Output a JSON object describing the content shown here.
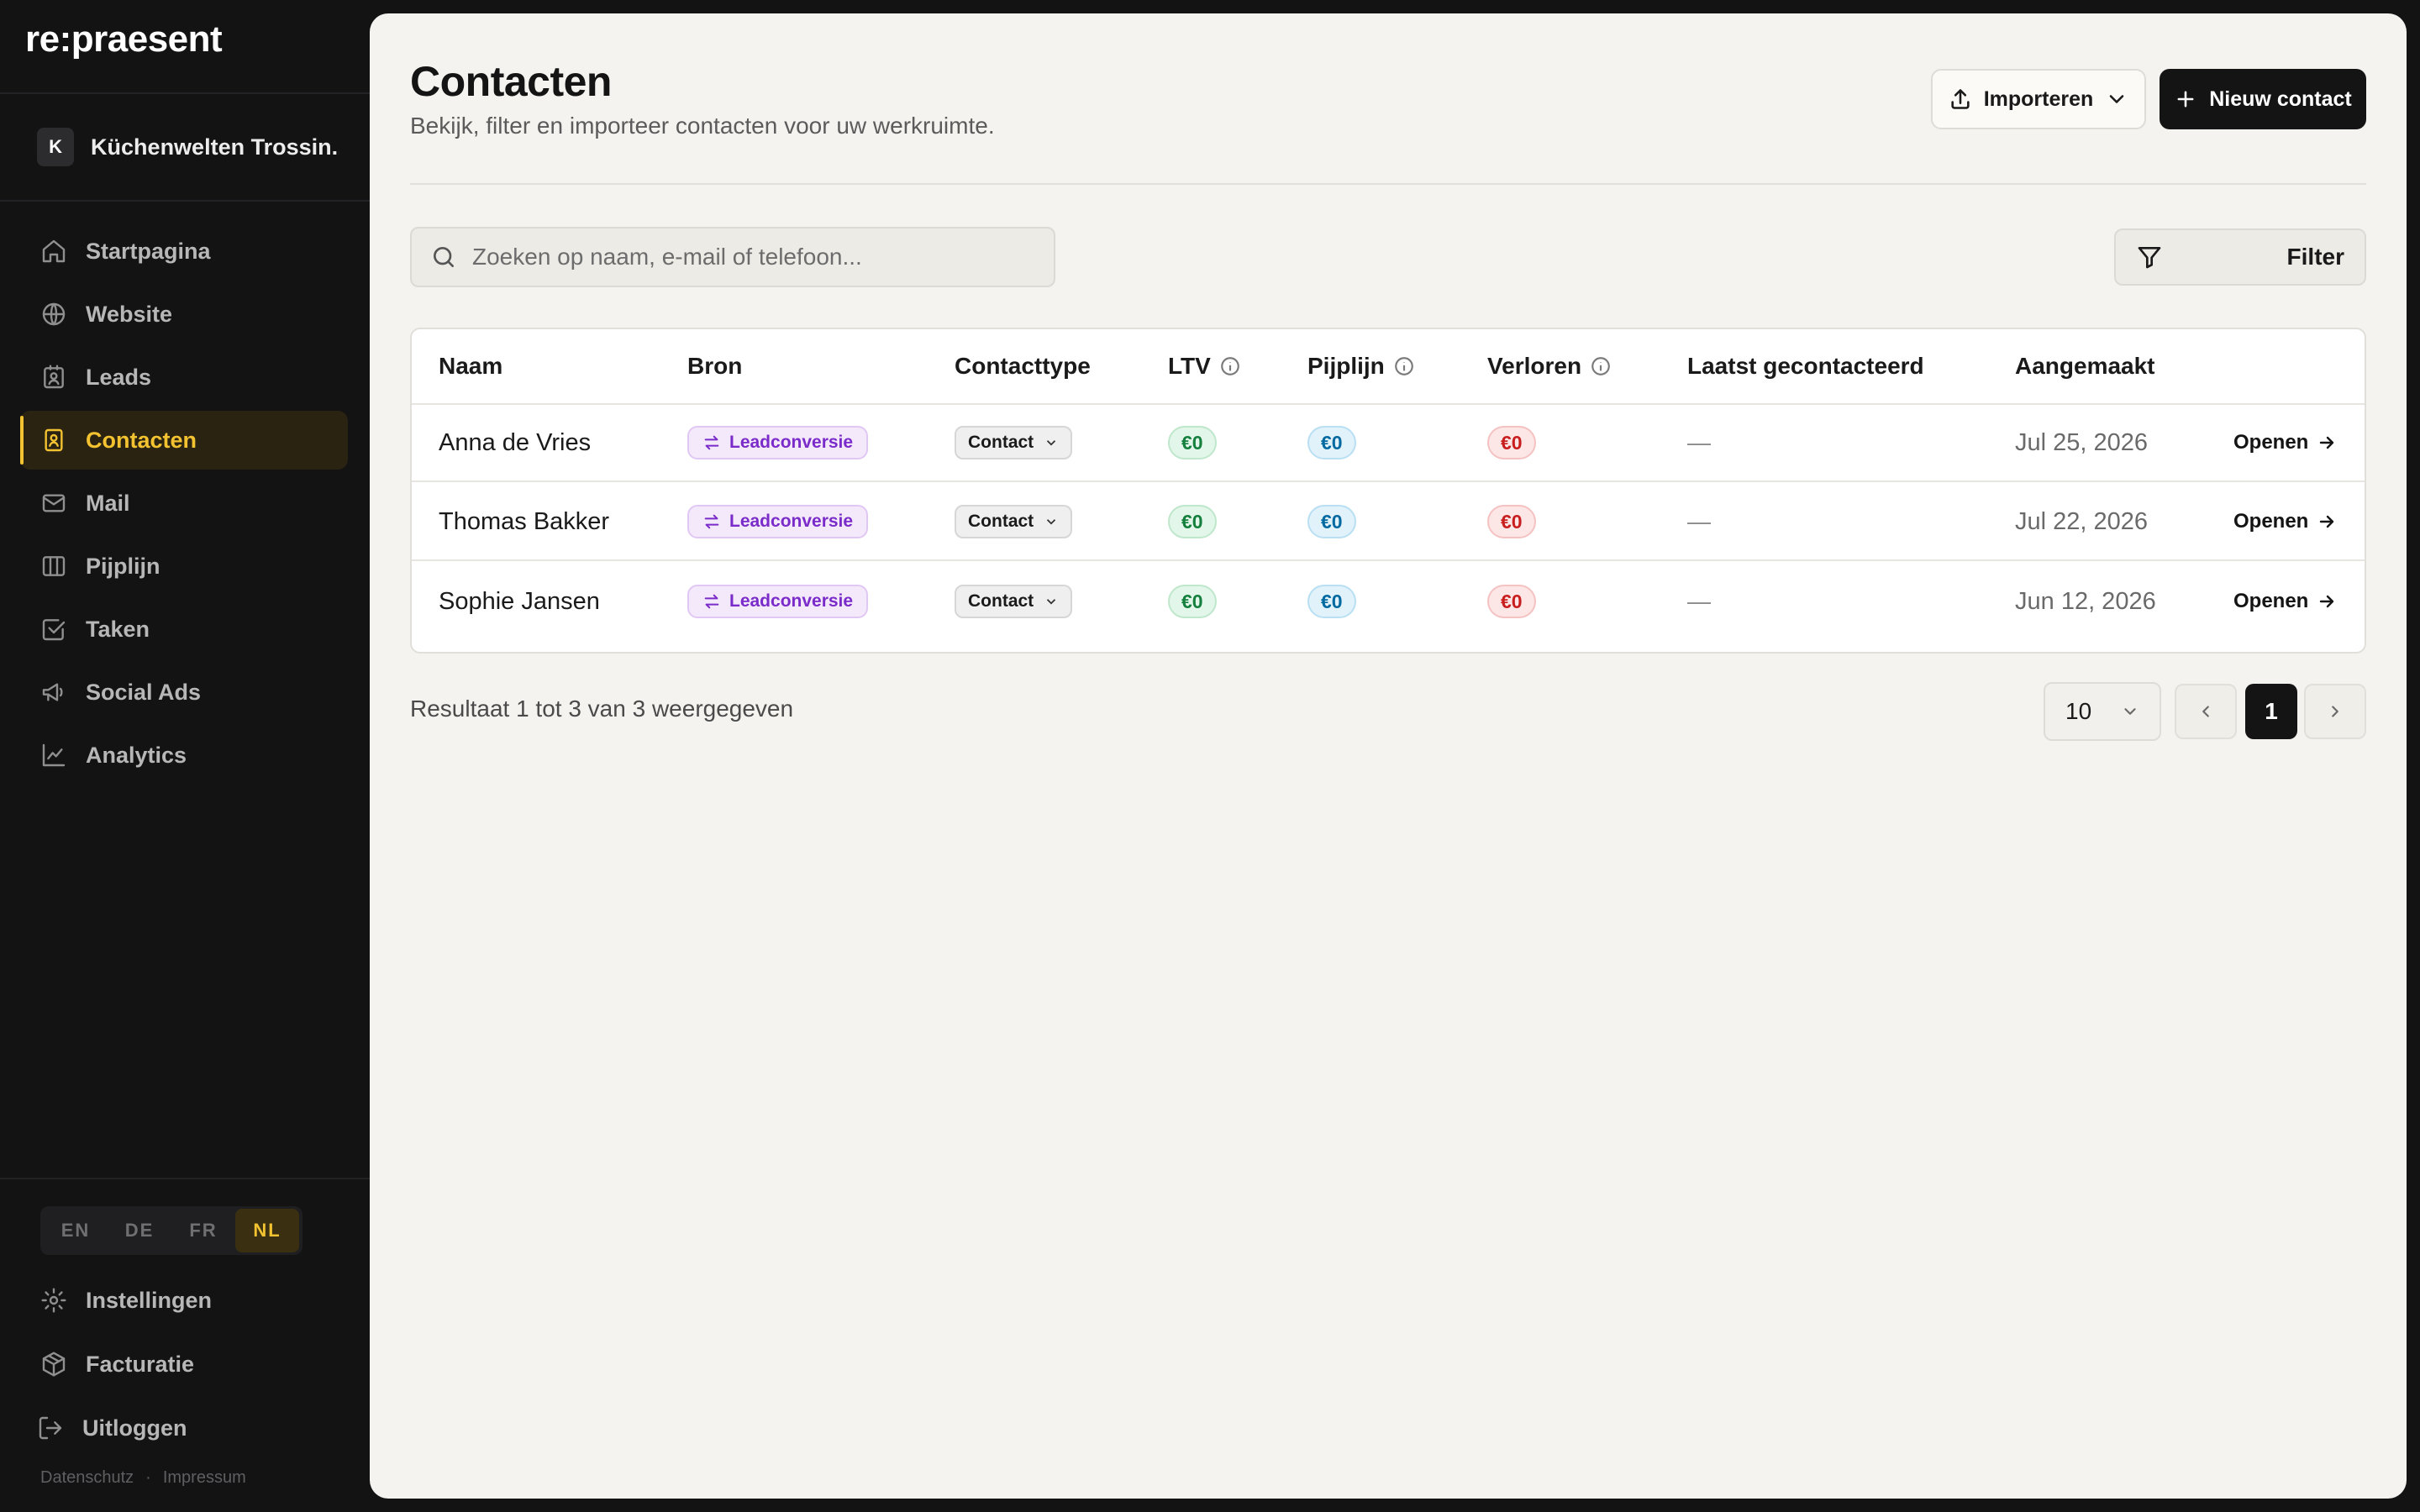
{
  "app": {
    "logo": "re:praesent"
  },
  "workspace": {
    "initial": "K",
    "name": "Küchenwelten Trossin..."
  },
  "sidebar": {
    "items": [
      {
        "label": "Startpagina",
        "icon": "home-icon"
      },
      {
        "label": "Website",
        "icon": "globe-icon"
      },
      {
        "label": "Leads",
        "icon": "contact-card-icon"
      },
      {
        "label": "Contacten",
        "icon": "contact-book-icon",
        "active": true
      },
      {
        "label": "Mail",
        "icon": "mail-icon"
      },
      {
        "label": "Pijplijn",
        "icon": "columns-icon"
      },
      {
        "label": "Taken",
        "icon": "checkbox-icon"
      },
      {
        "label": "Social Ads",
        "icon": "megaphone-icon"
      },
      {
        "label": "Analytics",
        "icon": "line-chart-icon"
      }
    ],
    "languages": [
      "EN",
      "DE",
      "FR",
      "NL"
    ],
    "active_language": "NL",
    "bottom_items": [
      {
        "label": "Instellingen",
        "icon": "gear-icon"
      },
      {
        "label": "Facturatie",
        "icon": "package-icon"
      },
      {
        "label": "Uitloggen",
        "icon": "logout-icon"
      }
    ],
    "footer": {
      "privacy": "Datenschutz",
      "separator": "·",
      "imprint": "Impressum"
    }
  },
  "header": {
    "title": "Contacten",
    "subtitle": "Bekijk, filter en importeer contacten voor uw werkruimte.",
    "import_label": "Importeren",
    "new_label": "Nieuw contact"
  },
  "search": {
    "placeholder": "Zoeken op naam, e-mail of telefoon...",
    "value": ""
  },
  "filter": {
    "label": "Filter"
  },
  "table": {
    "columns": {
      "naam": "Naam",
      "bron": "Bron",
      "type": "Contacttype",
      "ltv": "LTV",
      "pijplijn": "Pijplijn",
      "verloren": "Verloren",
      "laatst": "Laatst gecontacteerd",
      "aangemaakt": "Aangemaakt"
    },
    "rows": [
      {
        "naam": "Anna de Vries",
        "bron": "Leadconversie",
        "type": "Contact",
        "ltv": "€0",
        "pijplijn": "€0",
        "verloren": "€0",
        "laatst": "—",
        "aangemaakt": "Jul 25, 2026",
        "action": "Openen"
      },
      {
        "naam": "Thomas Bakker",
        "bron": "Leadconversie",
        "type": "Contact",
        "ltv": "€0",
        "pijplijn": "€0",
        "verloren": "€0",
        "laatst": "—",
        "aangemaakt": "Jul 22, 2026",
        "action": "Openen"
      },
      {
        "naam": "Sophie Jansen",
        "bron": "Leadconversie",
        "type": "Contact",
        "ltv": "€0",
        "pijplijn": "€0",
        "verloren": "€0",
        "laatst": "—",
        "aangemaakt": "Jun 12, 2026",
        "action": "Openen"
      }
    ]
  },
  "pagination": {
    "result_text": "Resultaat 1 tot 3 van 3 weergegeven",
    "page_size": "10",
    "current_page": "1"
  },
  "colors": {
    "accent": "#f2c230",
    "sidebar_bg": "#131314",
    "main_bg": "#f4f3ef"
  }
}
